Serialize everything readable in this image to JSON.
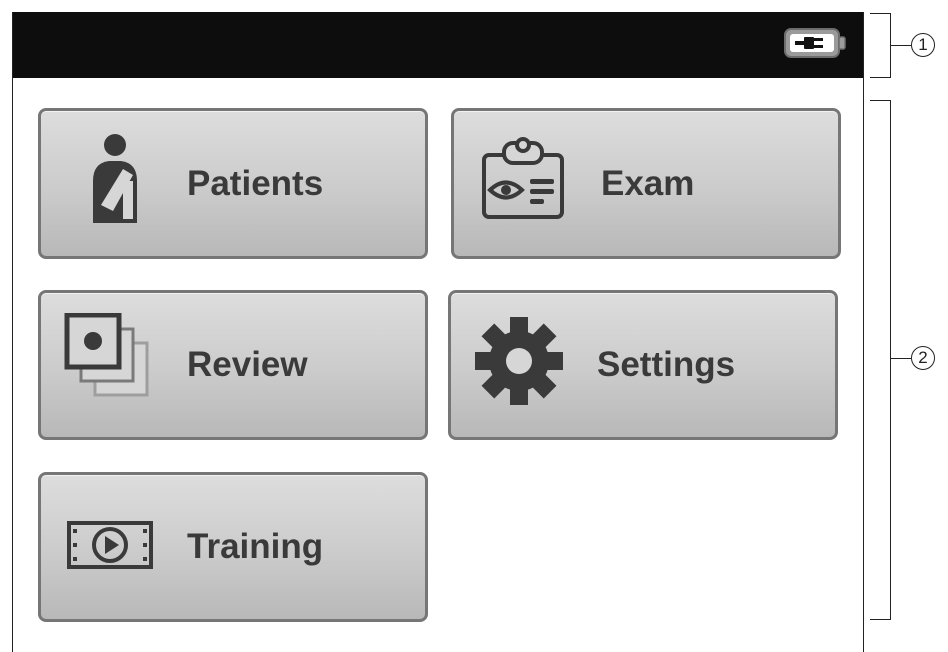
{
  "status_bar": {
    "battery_icon": "battery-plugged-icon"
  },
  "menu": {
    "tiles": [
      {
        "id": "patients",
        "label": "Patients",
        "icon": "patient-person-icon"
      },
      {
        "id": "exam",
        "label": "Exam",
        "icon": "exam-clipboard-eye-icon"
      },
      {
        "id": "review",
        "label": "Review",
        "icon": "review-image-stack-icon"
      },
      {
        "id": "settings",
        "label": "Settings",
        "icon": "gear-icon"
      },
      {
        "id": "training",
        "label": "Training",
        "icon": "video-play-icon"
      }
    ]
  },
  "callouts": {
    "top": "1",
    "main": "2"
  },
  "colors": {
    "status_bar_bg": "#0d0d0d",
    "tile_border": "#767676",
    "tile_fill": "#cbcbcb",
    "label": "#3a3a3a"
  }
}
